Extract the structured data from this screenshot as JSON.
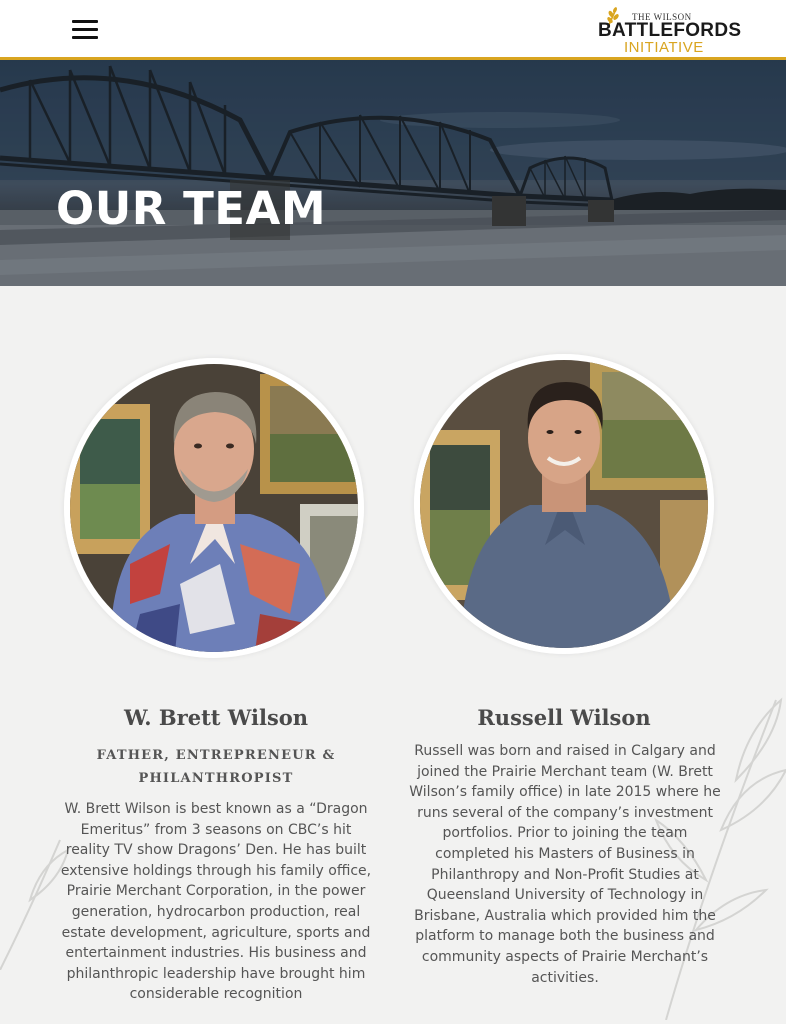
{
  "header": {
    "logo": {
      "line1": "THE WILSON",
      "line2": "BATTLEFORDS",
      "line3": "INITIATIVE"
    },
    "menu_icon": "hamburger-menu-icon",
    "accent_color": "#d9a520"
  },
  "hero": {
    "title": "OUR TEAM"
  },
  "team": [
    {
      "name": "W. Brett Wilson",
      "role": "FATHER, ENTREPRENEUR & PHILANTHROPIST",
      "bio": "W. Brett Wilson is best known as a “Dragon Emeritus” from 3 seasons on CBC’s hit reality TV show Dragons’ Den. He has built extensive holdings through his family office, Prairie Merchant Corporation, in the power generation, hydrocarbon production, real estate development, agriculture, sports and entertainment industries. His business and philanthropic leadership have brought him considerable recognition"
    },
    {
      "name": "Russell Wilson",
      "role": "",
      "bio": "Russell was born and raised in Calgary and joined the Prairie Merchant team (W. Brett Wilson’s family office) in late 2015 where he runs several of the company’s investment portfolios. Prior to joining the team completed his Masters of Business in Philanthropy and Non-Profit Studies at Queensland University of Technology in Brisbane, Australia which provided him the platform to manage both the business and community aspects of Prairie Merchant’s activities."
    }
  ]
}
